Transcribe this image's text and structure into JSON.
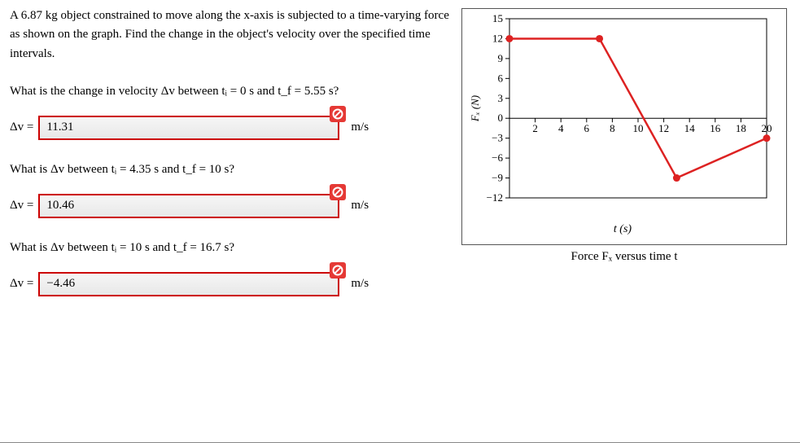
{
  "problem": {
    "intro": "A 6.87 kg object constrained to move along the x-axis is subjected to a time-varying force as shown on the graph. Find the change in the object's velocity over the specified time intervals.",
    "q1": "What is the change in velocity Δv between tᵢ = 0 s and t_f = 5.55 s?",
    "q2": "What is Δv between tᵢ = 4.35 s and t_f = 10 s?",
    "q3": "What is Δv between tᵢ = 10 s and t_f = 16.7 s?",
    "dv_label": "Δv =",
    "unit": "m/s"
  },
  "answers": {
    "a1": "11.31",
    "a2": "10.46",
    "a3": "−4.46"
  },
  "chart_data": {
    "type": "line",
    "title": "Force Fₓ versus time t",
    "xlabel": "t (s)",
    "ylabel": "Fₓ (N)",
    "xlim": [
      0,
      20
    ],
    "ylim": [
      -12,
      15
    ],
    "xticks": [
      2,
      4,
      6,
      8,
      10,
      12,
      14,
      16,
      18,
      20
    ],
    "yticks": [
      -12,
      -9,
      -6,
      -3,
      0,
      3,
      6,
      9,
      12,
      15
    ],
    "points": [
      {
        "x": 0,
        "y": 12
      },
      {
        "x": 7,
        "y": 12
      },
      {
        "x": 13,
        "y": -9
      },
      {
        "x": 20,
        "y": -3
      }
    ]
  }
}
